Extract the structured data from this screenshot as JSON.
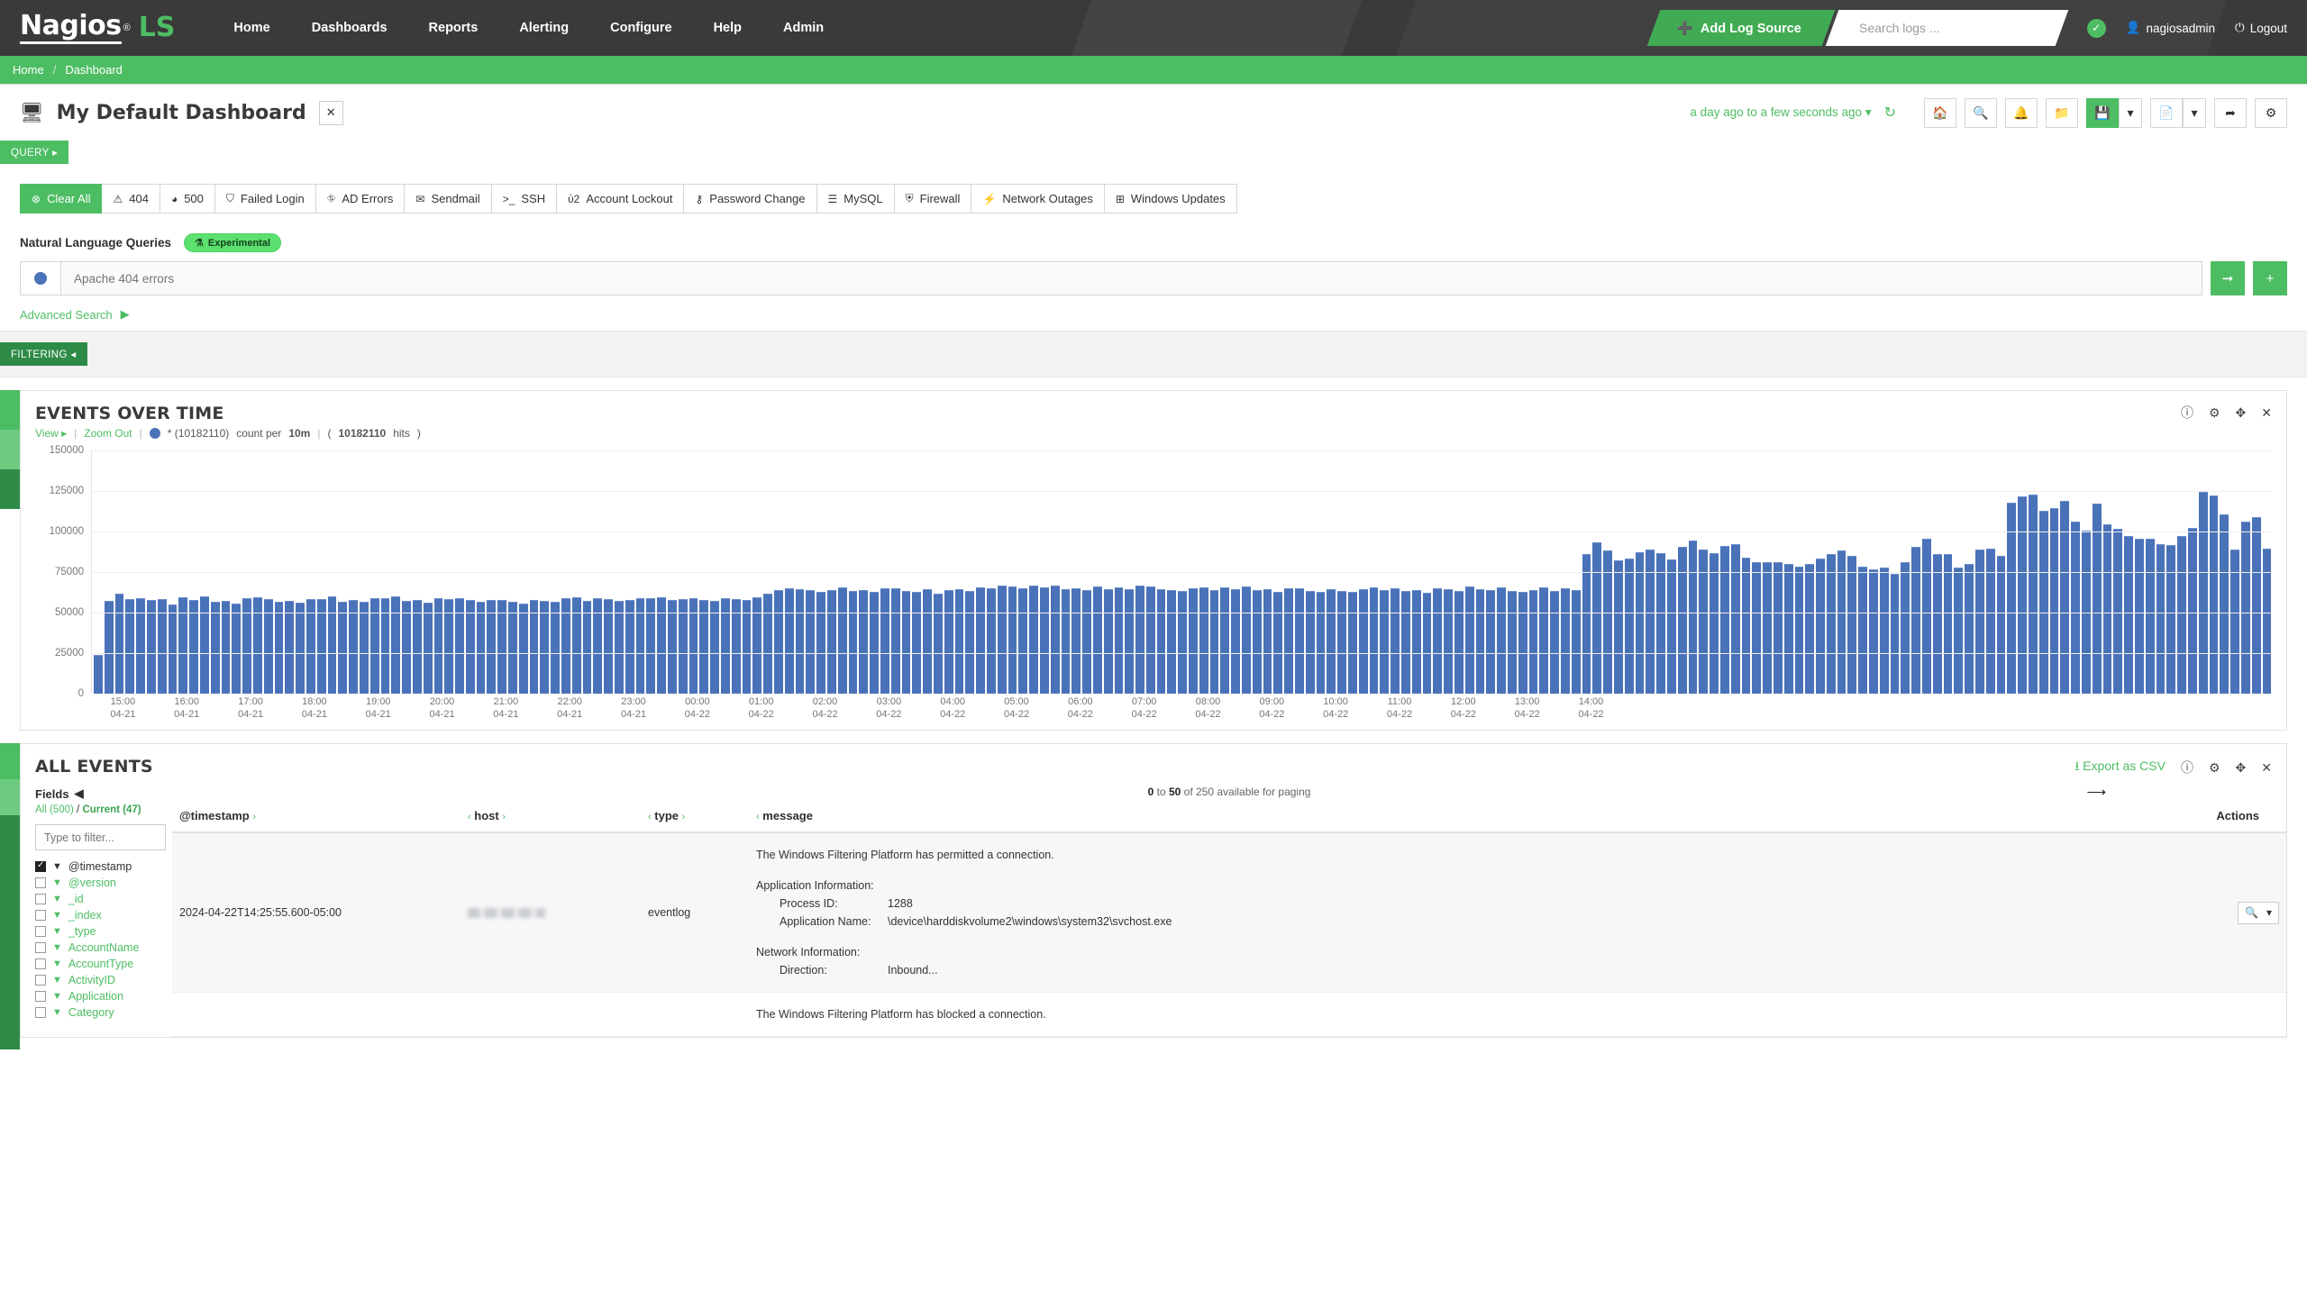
{
  "topnav": {
    "brand": {
      "name": "Nagios",
      "reg": "®",
      "suffix": "LS"
    },
    "links": [
      "Home",
      "Dashboards",
      "Reports",
      "Alerting",
      "Configure",
      "Help",
      "Admin"
    ],
    "add_log_source": "Add Log Source",
    "search_placeholder": "Search logs ...",
    "user": "nagiosadmin",
    "logout": "Logout"
  },
  "breadcrumb": {
    "home": "Home",
    "sep": "/",
    "current": "Dashboard"
  },
  "dashboard": {
    "title": "My Default Dashboard",
    "timerange": "a day ago to a few seconds ago",
    "toolbar": [
      "home",
      "search",
      "bell",
      "folder-open",
      "save",
      "save-caret",
      "document",
      "document-caret",
      "share",
      "gear"
    ]
  },
  "query": {
    "tab_label": "QUERY ▸",
    "buttons": [
      {
        "label": "Clear All",
        "icon": "⊗",
        "primary": true
      },
      {
        "label": "404",
        "icon": "⚠"
      },
      {
        "label": "500",
        "icon": "◕"
      },
      {
        "label": "Failed Login",
        "icon": "⛉"
      },
      {
        "label": "AD Errors",
        "icon": "⛗"
      },
      {
        "label": "Sendmail",
        "icon": "✉"
      },
      {
        "label": "SSH",
        "icon": ">_"
      },
      {
        "label": "Account Lockout",
        "icon": "ὑ2"
      },
      {
        "label": "Password Change",
        "icon": "⚷"
      },
      {
        "label": "MySQL",
        "icon": "☰"
      },
      {
        "label": "Firewall",
        "icon": "⛨"
      },
      {
        "label": "Network Outages",
        "icon": "⚡"
      },
      {
        "label": "Windows Updates",
        "icon": "⊞"
      }
    ],
    "nlq_title": "Natural Language Queries",
    "nlq_badge": "Experimental",
    "nlq_placeholder": "Apache 404 errors",
    "nlq_value": "",
    "advanced_search": "Advanced Search"
  },
  "filtering": {
    "tab_label": "FILTERING ◂"
  },
  "events_over_time": {
    "title": "EVENTS OVER TIME",
    "view": "View ▸",
    "zoom_out": "Zoom Out",
    "series_label": "* (10182110)",
    "count_per_prefix": "count per",
    "interval": "10m",
    "hits_count": "10182110",
    "hits_suffix": "hits"
  },
  "all_events": {
    "title": "ALL EVENTS",
    "export_csv": "Export as CSV",
    "fields_label": "Fields",
    "all_count": "All (500)",
    "current_count": "Current (47)",
    "filter_placeholder": "Type to filter...",
    "fields": [
      {
        "name": "@timestamp",
        "checked": true
      },
      {
        "name": "@version",
        "checked": false
      },
      {
        "name": "_id",
        "checked": false
      },
      {
        "name": "_index",
        "checked": false
      },
      {
        "name": "_type",
        "checked": false
      },
      {
        "name": "AccountName",
        "checked": false
      },
      {
        "name": "AccountType",
        "checked": false
      },
      {
        "name": "ActivityID",
        "checked": false
      },
      {
        "name": "Application",
        "checked": false
      },
      {
        "name": "Category",
        "checked": false
      }
    ],
    "paging": {
      "from": "0",
      "to_word": "to",
      "to": "50",
      "of_text": "of 250 available for paging"
    },
    "columns": [
      "@timestamp",
      "host",
      "type",
      "message",
      "Actions"
    ],
    "rows": [
      {
        "timestamp": "2024-04-22T14:25:55.600-05:00",
        "host": "",
        "type": "eventlog",
        "message_head": "The Windows Filtering Platform has permitted a connection.",
        "app_info_label": "Application Information:",
        "process_id_key": "Process ID:",
        "process_id_val": "1288",
        "app_name_key": "Application Name:",
        "app_name_val": "\\device\\harddiskvolume2\\windows\\system32\\svchost.exe",
        "net_info_label": "Network Information:",
        "direction_key": "Direction:",
        "direction_val": "Inbound..."
      },
      {
        "timestamp": "",
        "host": "",
        "type": "",
        "message_head": "The Windows Filtering Platform has blocked a connection.",
        "app_info_label": "",
        "process_id_key": "",
        "process_id_val": "",
        "app_name_key": "",
        "app_name_val": "",
        "net_info_label": "",
        "direction_key": "",
        "direction_val": ""
      }
    ]
  },
  "colors": {
    "brand_green": "#4dbd63",
    "dark_green": "#2e8b47",
    "bar_blue": "#4a72b8",
    "nav_dark": "#3a3a3a"
  },
  "chart_data": {
    "type": "bar",
    "title": "EVENTS OVER TIME",
    "xlabel": "",
    "ylabel": "",
    "ylim": [
      0,
      150000
    ],
    "yticks": [
      0,
      25000,
      50000,
      75000,
      100000,
      125000,
      150000
    ],
    "grid": true,
    "legend": "* (10182110)",
    "interval": "10m",
    "total_hits": 10182110,
    "xticks": [
      {
        "time": "15:00",
        "date": "04-21"
      },
      {
        "time": "16:00",
        "date": "04-21"
      },
      {
        "time": "17:00",
        "date": "04-21"
      },
      {
        "time": "18:00",
        "date": "04-21"
      },
      {
        "time": "19:00",
        "date": "04-21"
      },
      {
        "time": "20:00",
        "date": "04-21"
      },
      {
        "time": "21:00",
        "date": "04-21"
      },
      {
        "time": "22:00",
        "date": "04-21"
      },
      {
        "time": "23:00",
        "date": "04-21"
      },
      {
        "time": "00:00",
        "date": "04-22"
      },
      {
        "time": "01:00",
        "date": "04-22"
      },
      {
        "time": "02:00",
        "date": "04-22"
      },
      {
        "time": "03:00",
        "date": "04-22"
      },
      {
        "time": "04:00",
        "date": "04-22"
      },
      {
        "time": "05:00",
        "date": "04-22"
      },
      {
        "time": "06:00",
        "date": "04-22"
      },
      {
        "time": "07:00",
        "date": "04-22"
      },
      {
        "time": "08:00",
        "date": "04-22"
      },
      {
        "time": "09:00",
        "date": "04-22"
      },
      {
        "time": "10:00",
        "date": "04-22"
      },
      {
        "time": "11:00",
        "date": "04-22"
      },
      {
        "time": "12:00",
        "date": "04-22"
      },
      {
        "time": "13:00",
        "date": "04-22"
      },
      {
        "time": "14:00",
        "date": "04-22"
      }
    ],
    "values": [
      24000,
      57000,
      61500,
      58500,
      58800,
      57800,
      58600,
      55000,
      59200,
      58000,
      59800,
      56500,
      57400,
      55800,
      58800,
      59600,
      58300,
      56800,
      57000,
      56000,
      58600,
      58200,
      59800,
      56600,
      57800,
      56500,
      58700,
      59100,
      60200,
      57300,
      57800,
      55900,
      58900,
      58500,
      58900,
      57700,
      56800,
      58000,
      57900,
      56900,
      55400,
      57600,
      57300,
      56800,
      58900,
      59600,
      57100,
      59000,
      58400,
      57400,
      57900,
      59000,
      58700,
      59500,
      57900,
      58500,
      59100,
      58000,
      57400,
      58700,
      58600,
      57700,
      59600,
      61800,
      63800,
      65200,
      64200,
      63800,
      62900,
      63800,
      65400,
      63400,
      64100,
      62600,
      65000,
      64800,
      63200,
      62600,
      64600,
      61800,
      63900,
      64600,
      63200,
      65300,
      64800,
      66600,
      66200,
      64900,
      66800,
      65600,
      66400,
      64700,
      65200,
      63900,
      66100,
      64500,
      65600,
      64200,
      66900,
      66000,
      64200,
      63900,
      63100,
      64800,
      65400,
      63700,
      65600,
      64400,
      66100,
      63900,
      64300,
      62700,
      65000,
      64800,
      63500,
      62900,
      64200,
      63500,
      62900,
      64300,
      65400,
      64000,
      64800,
      63200,
      63900,
      62100,
      65100,
      64600,
      63500,
      66200,
      64700,
      63900,
      65800,
      63200,
      62800,
      64100,
      65500,
      63600,
      64900,
      63800,
      86000,
      93500,
      88500,
      82000,
      83500,
      87500,
      89000,
      86700,
      82800,
      90500,
      94200,
      89000,
      86600,
      91000,
      92000,
      83800,
      80900,
      81300,
      81000,
      79900,
      78500,
      80200,
      83600,
      85900,
      88300,
      85200,
      78200,
      76600,
      77600,
      74000,
      81000,
      90500,
      95500,
      86000,
      86200,
      78000,
      80200,
      89000,
      89200,
      85000,
      118000,
      121500,
      123000,
      113000,
      114500,
      118800,
      106000,
      100700,
      117500,
      104500,
      101800,
      97500,
      95800,
      95800,
      92200,
      91500,
      97300,
      102200,
      124500,
      122500,
      110500,
      88800,
      106000,
      108900,
      89600
    ]
  }
}
